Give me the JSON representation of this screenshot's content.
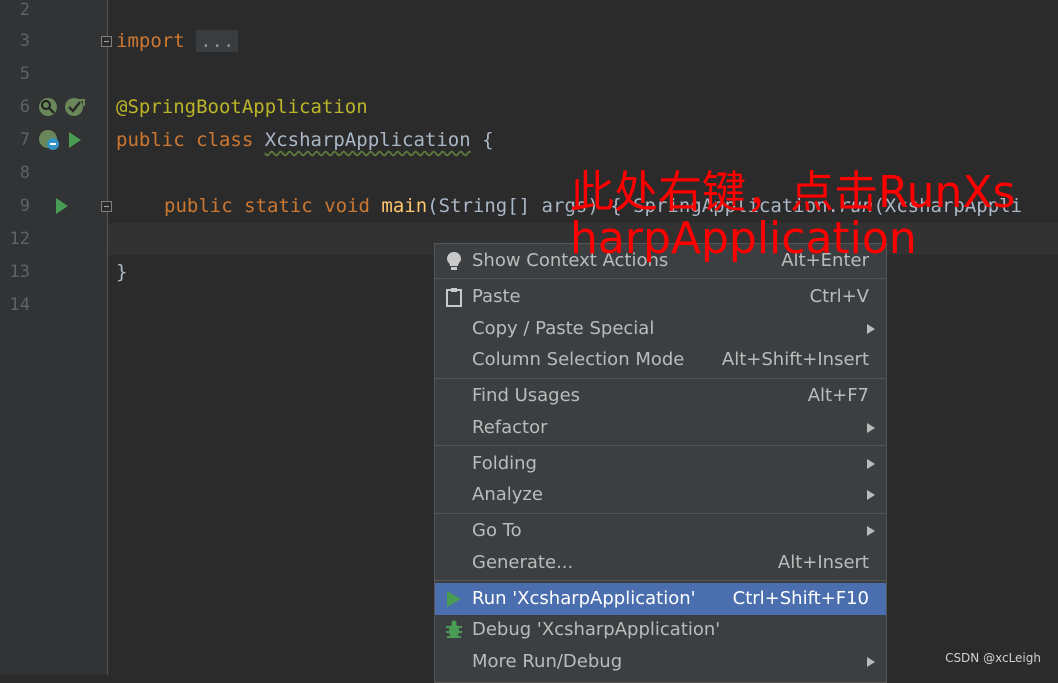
{
  "editor": {
    "line_numbers": [
      "2",
      "3",
      "5",
      "6",
      "7",
      "8",
      "9",
      "12",
      "13",
      "14"
    ],
    "line3": {
      "keyword": "import",
      "folded": "..."
    },
    "line6": {
      "annotation": "@SpringBootApplication"
    },
    "line7": {
      "kw1": "public",
      "kw2": "class",
      "class_name": "XcsharpApplication",
      "brace": "{"
    },
    "line9": {
      "kw1": "public",
      "kw2": "static",
      "kw3": "void",
      "method": "main",
      "params_a": "(String[] args) { ",
      "call_cls": "SpringApplication",
      "dot": ".",
      "call_fn": "run",
      "call_args": "(XcsharpAppli"
    },
    "line13": {
      "brace": "}"
    }
  },
  "context_menu": {
    "items": [
      {
        "label": "Show Context Actions",
        "shortcut": "Alt+Enter",
        "icon": "lightbulb-icon"
      },
      {
        "label": "Paste",
        "shortcut": "Ctrl+V",
        "icon": "clipboard-icon"
      },
      {
        "label": "Copy / Paste Special",
        "submenu": true
      },
      {
        "label": "Column Selection Mode",
        "shortcut": "Alt+Shift+Insert"
      },
      {
        "label": "Find Usages",
        "shortcut": "Alt+F7"
      },
      {
        "label": "Refactor",
        "submenu": true
      },
      {
        "label": "Folding",
        "submenu": true
      },
      {
        "label": "Analyze",
        "submenu": true
      },
      {
        "label": "Go To",
        "submenu": true
      },
      {
        "label": "Generate...",
        "shortcut": "Alt+Insert"
      },
      {
        "label": "Run 'XcsharpApplication'",
        "shortcut": "Ctrl+Shift+F10",
        "icon": "run-icon",
        "highlighted": true
      },
      {
        "label": "Debug 'XcsharpApplication'",
        "icon": "debug-icon"
      },
      {
        "label": "More Run/Debug",
        "submenu": true
      }
    ]
  },
  "annotation_text": "此处右键，点击RunXsharpApplication",
  "watermark": "CSDN @xcLeigh",
  "colors": {
    "editor_bg": "#2b2b2b",
    "gutter_bg": "#313335",
    "menu_bg": "#3c3f41",
    "highlight": "#4b6eaf",
    "keyword": "#cc7832",
    "annotation": "#bbb529",
    "method": "#ffc66d",
    "run_green": "#499c54",
    "overlay_red": "#ff0000"
  }
}
